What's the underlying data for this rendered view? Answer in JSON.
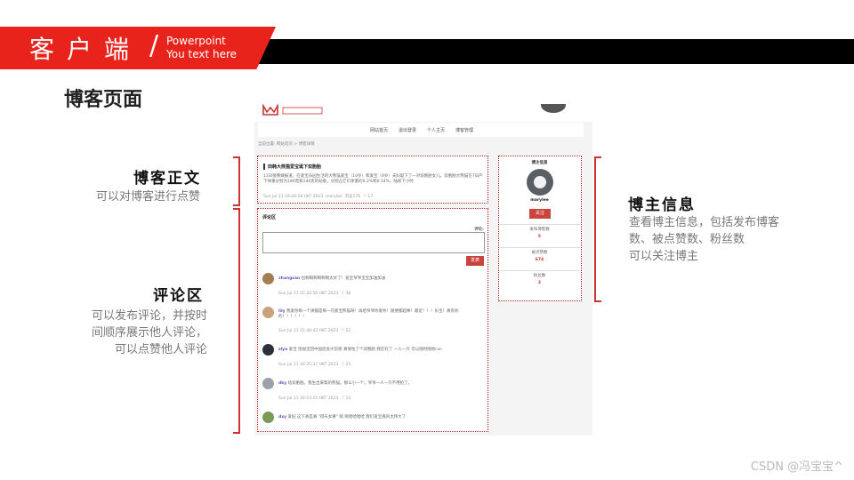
{
  "header": {
    "title": "客户端",
    "slash": "/",
    "sub_line1": "Powerpoint",
    "sub_line2": "You text here"
  },
  "page_title": "博客页面",
  "annotations": {
    "body": {
      "heading": "博客正文",
      "desc": "可以对博客进行点赞"
    },
    "comments": {
      "heading": "评论区",
      "desc_lines": [
        "可以发布评论，并按时",
        "间顺序展示他人评论，",
        "可以点赞他人评论"
      ]
    },
    "author": {
      "heading": "博主信息",
      "desc_lines": [
        "查看博主信息，包括发布博客",
        "数、被点赞数、粉丝数",
        "可以关注博主"
      ]
    }
  },
  "mockup": {
    "nav": [
      "网站首页",
      "退出登录",
      "个人主页",
      "博客管理"
    ],
    "breadcrumb": "当前位置: 网站首页 > 博客详情",
    "post": {
      "title": "田韩大熊猫爱宝诞下双胞胎",
      "body": "11日接韩媒报道，在爱宝乐园生活的大熊猫爱宝（10岁）和爱宝（9岁）夫妇诞下了一对双胞胎女儿。双胞胎大熊猫在7日产下体重分别为180克和140克的幼崽，分别占它们体重的0.2%和0.14%，陆续下小时",
      "meta": "Sun Jul 11 18:26:18 HKT 2023",
      "author": "marylee",
      "views": "浏览176",
      "likes": "17"
    },
    "comments_title": "评论区",
    "comment_label": "评论:",
    "submit_label": "发表",
    "comments": [
      {
        "user": "zhangsan",
        "text": "拉啊啊啊啊啊啊太好了！爱宝爷爷宝宝加油加油",
        "time": "Sun Jul 11 15:20:56 HKT 2023",
        "likes": "36"
      },
      {
        "user": "lily",
        "text": "我爱你每一个讲都是每一句爱宝熊猫呀！再给爷爷你爱你！随便都超棒！最近！！！乐宝！真有你的！！！！！！",
        "time": "Sun Jul 11 15:48:43 HKT 2023",
        "likes": "22"
      },
      {
        "user": "zlya",
        "text": "爱宝 恰福宝回中国后会大伤感 真保住了个双胞胎 我在好了 一人一只 可以随时随地run",
        "time": "Sun Jul 11 16:25:37 HKT 2023",
        "likes": "21"
      },
      {
        "user": "dky",
        "text": "啥双胞胎。我生出来帮的熊猫。那么小一个。爷爷一人一只不用抢了。",
        "time": "Sun Jul 11 16:23:15 HKT 2023",
        "likes": "14"
      },
      {
        "user": "dxy",
        "text": "爱妃 这下真是真 \"得天女奢\" 啊 啊哈哈哈哈 我们爱宝真的太伟大了",
        "time": "",
        "likes": ""
      }
    ],
    "author_card": {
      "title": "博主信息",
      "name": "marylee",
      "follow_label": "关注",
      "stats": [
        {
          "label": "发布博客数",
          "value": "5"
        },
        {
          "label": "被点赞数",
          "value": "674"
        },
        {
          "label": "粉丝数",
          "value": "2"
        }
      ]
    }
  },
  "watermark": "CSDN @冯宝宝^"
}
